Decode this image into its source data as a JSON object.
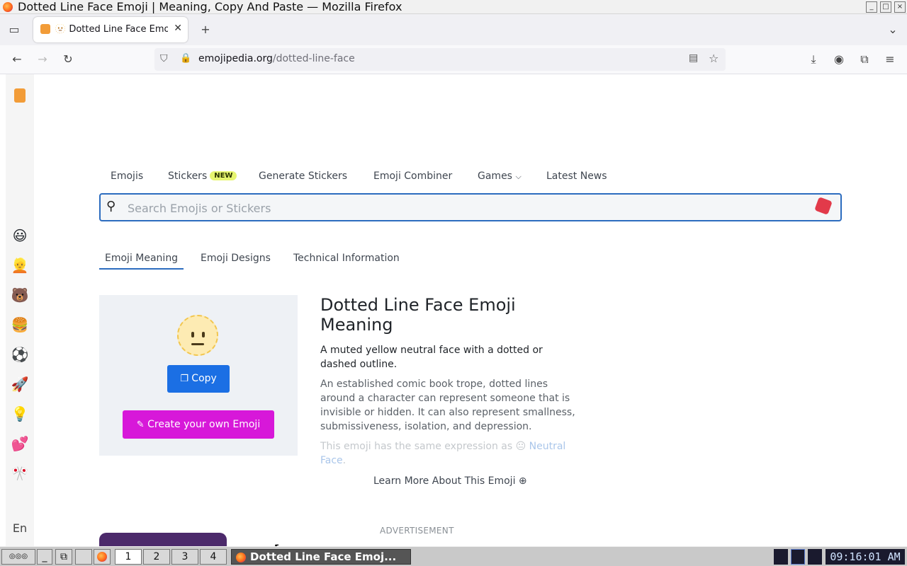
{
  "window": {
    "title": "Dotted Line Face Emoji | Meaning, Copy And Paste — Mozilla Firefox"
  },
  "browser": {
    "tab_label": "🫥 Dotted Line Face Emoji",
    "url_domain": "emojipedia.org",
    "url_path": "/dotted-line-face"
  },
  "sidebar": {
    "icons": [
      "😃",
      "👱",
      "🐻",
      "🍔",
      "⚽",
      "🚀",
      "💡",
      "💕",
      "🎌"
    ],
    "lang": "En"
  },
  "site_nav": {
    "emojis": "Emojis",
    "stickers": "Stickers",
    "stickers_badge": "NEW",
    "generate": "Generate Stickers",
    "combiner": "Emoji Combiner",
    "games": "Games",
    "news": "Latest News"
  },
  "search": {
    "placeholder": "Search Emojis or Stickers"
  },
  "subtabs": {
    "meaning": "Emoji Meaning",
    "designs": "Emoji Designs",
    "technical": "Technical Information"
  },
  "card": {
    "copy": "Copy",
    "create": "Create your own Emoji"
  },
  "content": {
    "title": "Dotted Line Face Emoji Meaning",
    "summary": "A muted yellow neutral face with a dotted or dashed outline.",
    "body": "An established comic book trope, dotted lines around a character can represent someone that is invisible or hidden. It can also represent smallness, submissiveness, isolation, and depression.",
    "faded_prefix": "This emoji has the same expression as 😐 ",
    "faded_link": "Neutral Face",
    "faded_suffix": ".",
    "learn_more": "Learn More About This Emoji"
  },
  "ad": {
    "label": "ADVERTISEMENT"
  },
  "taskbar": {
    "workspaces": [
      "1",
      "2",
      "3",
      "4"
    ],
    "active_task": "Dotted Line Face Emoj...",
    "clock": "09:16:01 AM"
  },
  "colors": {
    "accent": "#1b6fe4",
    "create_button": "#d718d9",
    "badge": "#e6f570",
    "search_border": "#2c6cbf"
  }
}
